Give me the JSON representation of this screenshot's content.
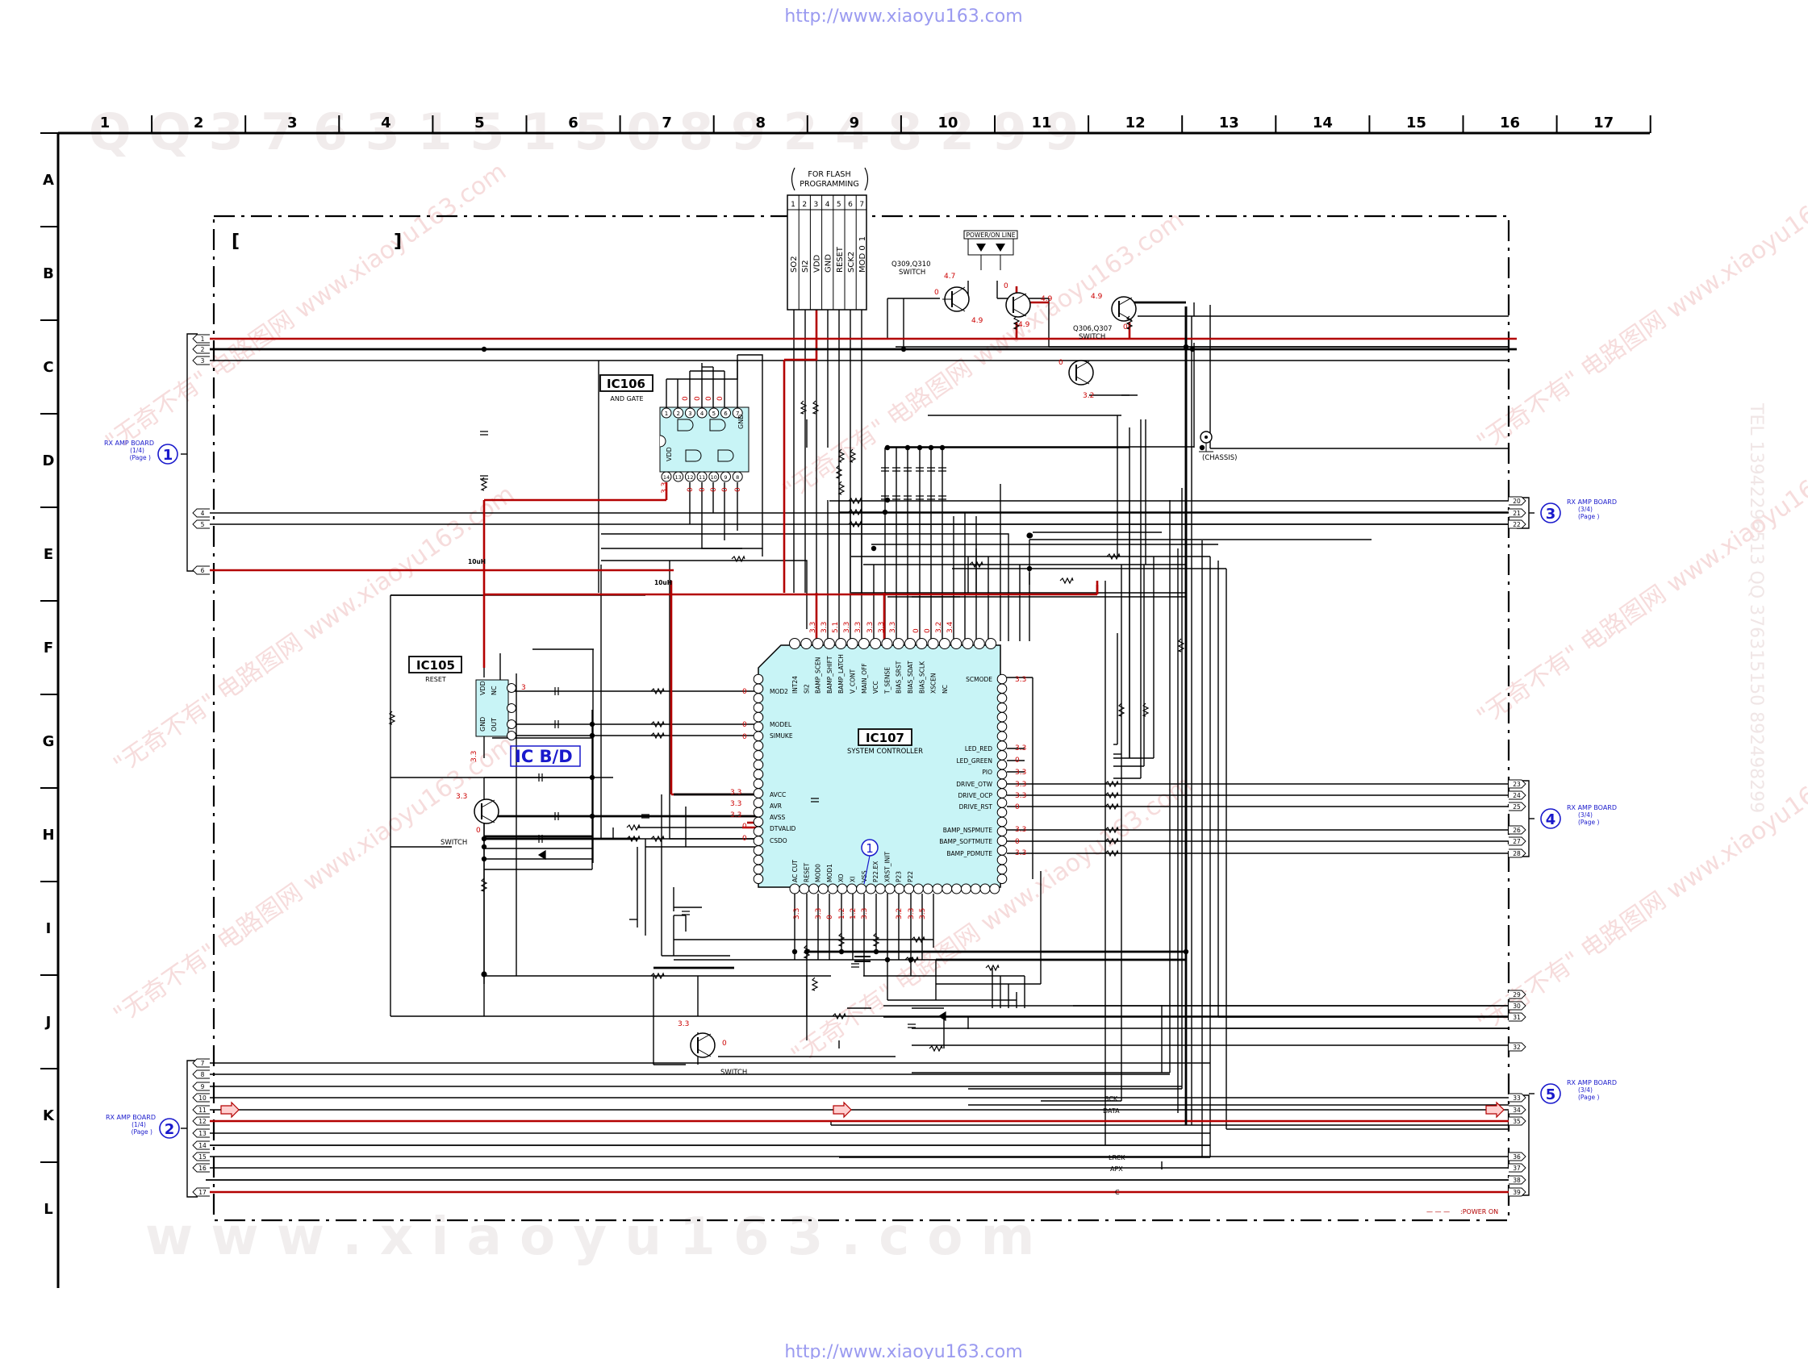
{
  "header_url": "http://www.xiaoyu163.com",
  "footer_url": "http://www.xiaoyu163.com",
  "columns": [
    "1",
    "2",
    "3",
    "4",
    "5",
    "6",
    "7",
    "8",
    "9",
    "10",
    "11",
    "12",
    "13",
    "14",
    "15",
    "16",
    "17"
  ],
  "rows": [
    "A",
    "B",
    "C",
    "D",
    "E",
    "F",
    "G",
    "H",
    "I",
    "J",
    "K",
    "L"
  ],
  "watermark_bottom": "w w w . x i a o y u 1 6 3 . c o m",
  "watermark_top": "Q Q 3 7 6 3 1 5 1 5 0   8 9 2 4 8 2 9 9",
  "watermark_side": "TEL 13942296513  QQ 376315150  892498299",
  "watermark_cn": "\"无奇不有\" 电路图网 www.xiaoyu163.com",
  "flash": {
    "title": "FOR FLASH",
    "subtitle": "PROGRAMMING",
    "pins": [
      "1",
      "2",
      "3",
      "4",
      "5",
      "6",
      "7"
    ],
    "signals": [
      "SO2",
      "SI2",
      "VDD",
      "GND",
      "RESET",
      "SCK2",
      "MOD 0_1"
    ]
  },
  "ic106": {
    "ref": "IC106",
    "desc": "AND GATE",
    "pins_top": [
      "1",
      "2",
      "3",
      "4",
      "5",
      "6",
      "7"
    ],
    "pins_bottom": [
      "14",
      "13",
      "12",
      "11",
      "10",
      "9",
      "8"
    ],
    "vdd": "VDD",
    "gnd": "GND"
  },
  "ic105": {
    "ref": "IC105",
    "desc": "RESET",
    "pins": [
      "VDD",
      "NC",
      "GND",
      "OUT"
    ]
  },
  "ic107": {
    "ref": "IC107",
    "desc": "SYSTEM CONTROLLER",
    "top_pins": [
      "INT24",
      "SI2",
      "BAMP_SCEN",
      "BAMP_SHIFT",
      "BAMP_LATCH",
      "V_CONT",
      "MAIN_OFF",
      "VCC",
      "T_SENSE",
      "BIAS_SRST",
      "BIAS_SDAT",
      "BIAS_SCLK",
      "XSCEN",
      "NC"
    ],
    "left_pins": [
      "MOD2",
      "MODEL",
      "SIMUKE",
      "AVCC",
      "AVR",
      "AVSS",
      "DTVALID",
      "CSDO"
    ],
    "right_pins": [
      "SCMODE",
      "LED_RED",
      "LED_GREEN",
      "PIO",
      "DRIVE_OTW",
      "DRIVE_OCP",
      "DRIVE_RST",
      "BAMP_NSPMUTE",
      "BAMP_SOFTMUTE",
      "BAMP_PDMUTE"
    ],
    "bottom_pins": [
      "AC CUT",
      "RESET",
      "MOD0",
      "MOD1",
      "XO",
      "XI",
      "VSS",
      "P22.EX",
      "XRST_INIT",
      "P23",
      "P22"
    ]
  },
  "ic_bd": "IC B/D",
  "transistors": {
    "q309": "Q309,Q310",
    "switch": "SWITCH",
    "q306": "Q306,Q307",
    "power_on_line": "POWER/ON LINE",
    "chassis": "(CHASSIS)"
  },
  "connectors": [
    {
      "num": "1",
      "title": "RX AMP BOARD",
      "sub": "(1/4)",
      "page": "(Page    )"
    },
    {
      "num": "2",
      "title": "RX AMP BOARD",
      "sub": "(1/4)",
      "page": "(Page    )"
    },
    {
      "num": "3",
      "title": "RX AMP BOARD",
      "sub": "(3/4)",
      "page": "(Page    )"
    },
    {
      "num": "4",
      "title": "RX AMP BOARD",
      "sub": "(3/4)",
      "page": "(Page    )"
    },
    {
      "num": "5",
      "title": "RX AMP BOARD",
      "sub": "(3/4)",
      "page": "(Page    )"
    }
  ],
  "left_terms_top": [
    "1",
    "2",
    "3",
    "4",
    "5",
    "6"
  ],
  "left_terms_bottom": [
    "7",
    "8",
    "9",
    "10",
    "11",
    "12",
    "13",
    "14",
    "15",
    "16",
    "17"
  ],
  "right_terms_3": [
    "20",
    "21",
    "22"
  ],
  "right_terms_4": [
    "23",
    "24",
    "25",
    "26",
    "27",
    "28"
  ],
  "right_terms_j": [
    "29",
    "30",
    "31",
    "32"
  ],
  "right_terms_5": [
    "33",
    "34",
    "35",
    "36",
    "37",
    "38",
    "39"
  ],
  "net_labels": {
    "bck": "BCK",
    "data": "DATA",
    "lrck": "LRCK",
    "apx": "APX",
    "c": "C"
  },
  "voltages": {
    "v33": "3.3",
    "v0": "0",
    "v3": "3",
    "v49": "4.9",
    "v47": "4.7",
    "v32": "3.2",
    "v36": "3.6",
    "v12": "1.2",
    "v35": "3.5",
    "v51": "5.1",
    "v34": "3.4"
  },
  "components": {
    "l1": "10uH",
    "l2": "10uH"
  },
  "legend": ":POWER ON",
  "legend_prefix": "— — — ",
  "chip_marker": "1",
  "bracket_l": "[",
  "bracket_r": "]"
}
